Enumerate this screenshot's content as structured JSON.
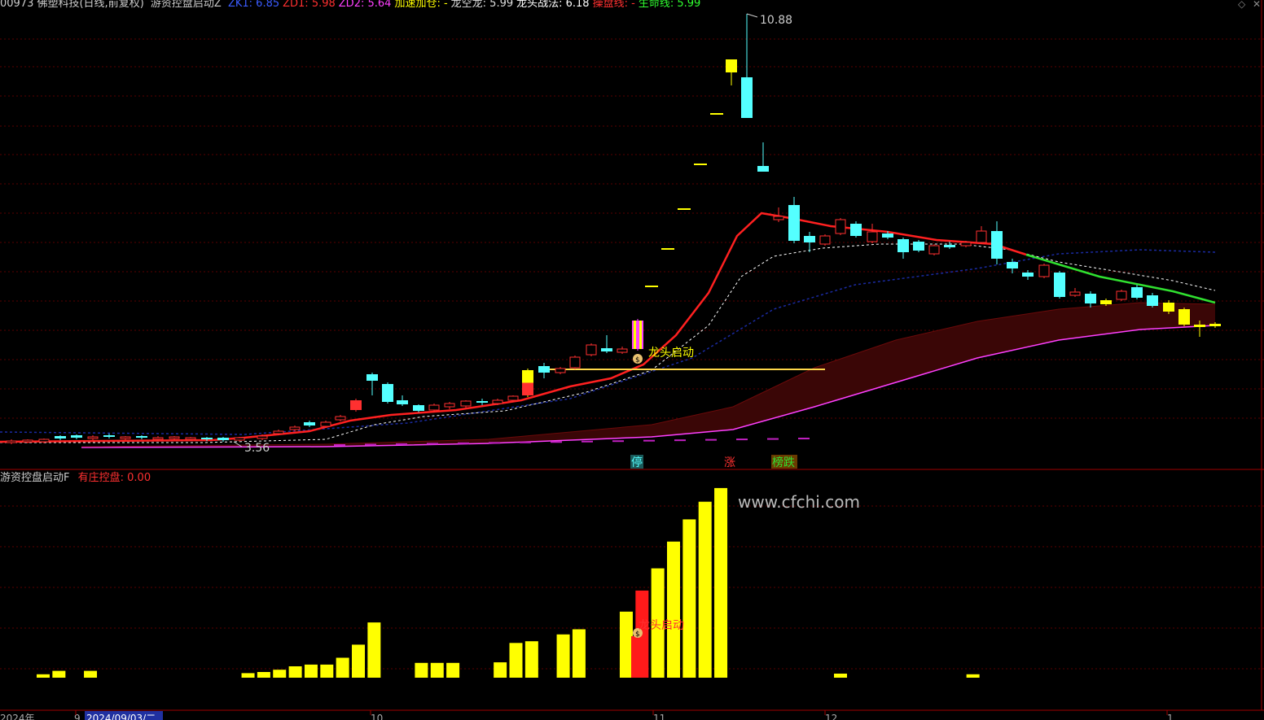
{
  "main_header": {
    "stock": "00973 佛塑科技(日线,前复权)",
    "indicator": "游资控盘启动Z",
    "items": [
      {
        "label": "ZK1: ",
        "value": "6.85",
        "color": "#3b5cff"
      },
      {
        "label": "ZD1: ",
        "value": "5.98",
        "color": "#ff3030"
      },
      {
        "label": "ZD2: ",
        "value": "5.64",
        "color": "#ff40ff"
      },
      {
        "label": "加速加仓: ",
        "value": "-",
        "color": "#ffff00"
      },
      {
        "label": "龙空龙: ",
        "value": "5.99",
        "color": "#dddddd"
      },
      {
        "label": "龙头战法: ",
        "value": "6.18",
        "color": "#ffffff"
      },
      {
        "label": "操盘线: ",
        "value": "-",
        "color": "#ff3030"
      },
      {
        "label": "生命线: ",
        "value": "5.99",
        "color": "#30ff30"
      }
    ]
  },
  "main_annotations": {
    "high_price": "10.88",
    "low_price": "3.56",
    "signal_label": "龙头启动",
    "tag_stop": "停",
    "tag_rise": "涨",
    "tag_list": "榜跌"
  },
  "sub_header": {
    "indicator": "游资控盘启动F",
    "label": "有庄控盘: ",
    "value": "0.00"
  },
  "sub_annotations": {
    "signal_label": "龙头启动",
    "watermark": "www.cfchi.com"
  },
  "date_axis": {
    "year": "2024年",
    "nine": "9",
    "selected_date": "2024/09/03/二",
    "ten": "10",
    "eleven": "11",
    "twelve": "12",
    "one": "1"
  },
  "colors": {
    "up": "#ff3030",
    "down": "#54ffff",
    "yellow": "#ffff00",
    "magenta": "#ff40ff",
    "green": "#30e030",
    "navy": "#1a2aa0",
    "band": "#3a0606"
  },
  "chart_data": {
    "type": "candlestick",
    "price_high": 10.88,
    "price_low": 3.56,
    "volume_bars": [
      0.6,
      1.2,
      0,
      1.2,
      0,
      0,
      0,
      0,
      0,
      0,
      0,
      0,
      0,
      0.8,
      1.0,
      1.4,
      2.0,
      2.3,
      2.3,
      3.5,
      5.8,
      9.7,
      0,
      0,
      2.6,
      2.6,
      2.6,
      0,
      0,
      2.7,
      6.1,
      6.4,
      0,
      7.6,
      8.5,
      0,
      0,
      11.6,
      15.3,
      19.2,
      23.9,
      27.8,
      30.9,
      33.3,
      0,
      0,
      0,
      0,
      0,
      0,
      0,
      0,
      0,
      0,
      0,
      0,
      0,
      0,
      0,
      0.6
    ]
  }
}
